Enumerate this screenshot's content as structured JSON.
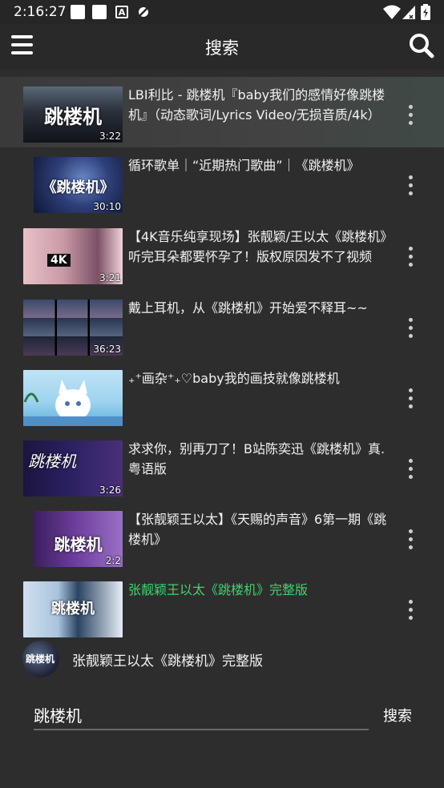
{
  "status_bar": {
    "time": "2:16:27",
    "icons": [
      "notification-square-icon",
      "notification-square-icon",
      "a-badge-icon",
      "cast-off-icon",
      "wifi-icon",
      "signal-icon",
      "battery-icon"
    ],
    "a_badge": "A"
  },
  "app_bar": {
    "title": "搜索",
    "menu_icon": "hamburger-menu-icon",
    "search_icon": "search-icon"
  },
  "results": [
    {
      "title": "LBI利比 - 跳楼机『baby我们的感情好像跳楼机』（动态歌词/Lyrics Video/无损音质/4k）",
      "duration": "3:22",
      "thumb_text": "跳楼机",
      "highlighted": true,
      "title_color": "#f2f2f2"
    },
    {
      "title": "循环歌单｜“近期热门歌曲”｜《跳楼机》",
      "duration": "30:10",
      "thumb_text": "《跳楼机》",
      "highlighted": false
    },
    {
      "title": "【4K音乐纯享现场】张靓颖/王以太《跳楼机》听完耳朵都要怀孕了！版权原因发不了视频",
      "duration": "3:21",
      "thumb_text": "4K",
      "highlighted": false
    },
    {
      "title": "戴上耳机，从《跳楼机》开始爱不释耳~~",
      "duration": "36:23",
      "thumb_text": "",
      "highlighted": false
    },
    {
      "title": "₊⁺画杂⁺₊♡baby我的画技就像跳楼机",
      "duration": "",
      "thumb_text": "",
      "highlighted": false
    },
    {
      "title": "求求你，别再刀了！B站陈奕迅《跳楼机》真.粤语版",
      "duration": "3:26",
      "thumb_text": "跳楼机",
      "highlighted": false
    },
    {
      "title": "【张靓颖王以太】《天赐的声音》6第一期《跳楼机》",
      "duration": "2:2",
      "thumb_text": "跳楼机",
      "highlighted": false
    },
    {
      "title": "张靓颖王以太《跳楼机》完整版",
      "duration": "",
      "thumb_text": "跳楼机",
      "highlighted": false,
      "title_color": "#3dd36f"
    }
  ],
  "suggestion": {
    "label": "张靓颖王以太《跳楼机》完整版",
    "avatar_text": "跳楼机"
  },
  "search": {
    "value": "跳楼机",
    "button_label": "搜索"
  },
  "colors": {
    "background": "#2e2d2d",
    "accent_green": "#3dd36f"
  }
}
